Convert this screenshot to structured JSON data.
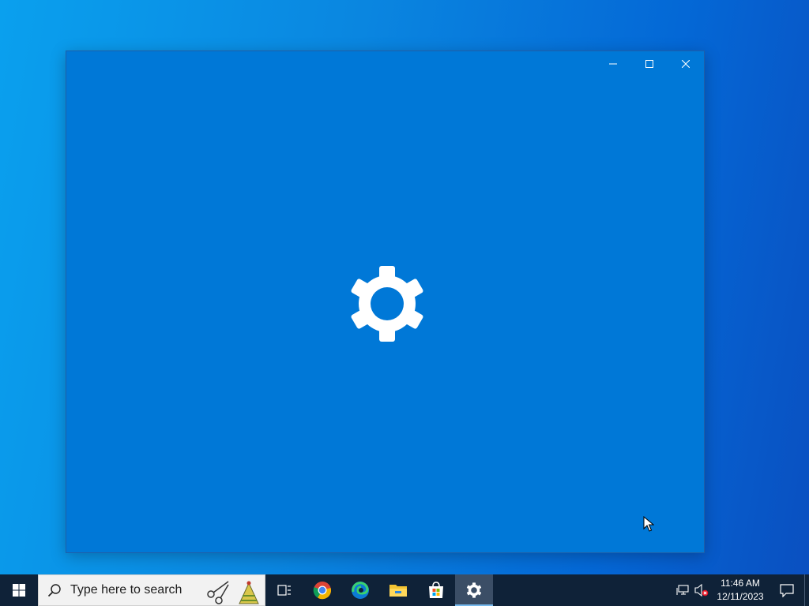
{
  "window": {
    "minimize_icon": "minimize-icon",
    "maximize_icon": "maximize-icon",
    "close_icon": "close-icon",
    "splash_icon": "gear-icon",
    "background_color": "#0078d7"
  },
  "taskbar": {
    "start_icon": "windows-logo-icon",
    "search": {
      "placeholder": "Type here to search"
    },
    "apps": [
      {
        "name": "Task View",
        "icon": "task-view-icon"
      },
      {
        "name": "Google Chrome",
        "icon": "chrome-icon"
      },
      {
        "name": "Microsoft Edge",
        "icon": "edge-icon"
      },
      {
        "name": "File Explorer",
        "icon": "folder-icon"
      },
      {
        "name": "Microsoft Store",
        "icon": "store-icon"
      },
      {
        "name": "Settings",
        "icon": "gear-icon",
        "active": true
      }
    ],
    "tray": {
      "network_icon": "network-icon",
      "volume_icon": "volume-muted-icon",
      "time": "11:46 AM",
      "date": "12/11/2023",
      "notifications_icon": "notification-icon"
    },
    "background_color": "#0f2238"
  }
}
